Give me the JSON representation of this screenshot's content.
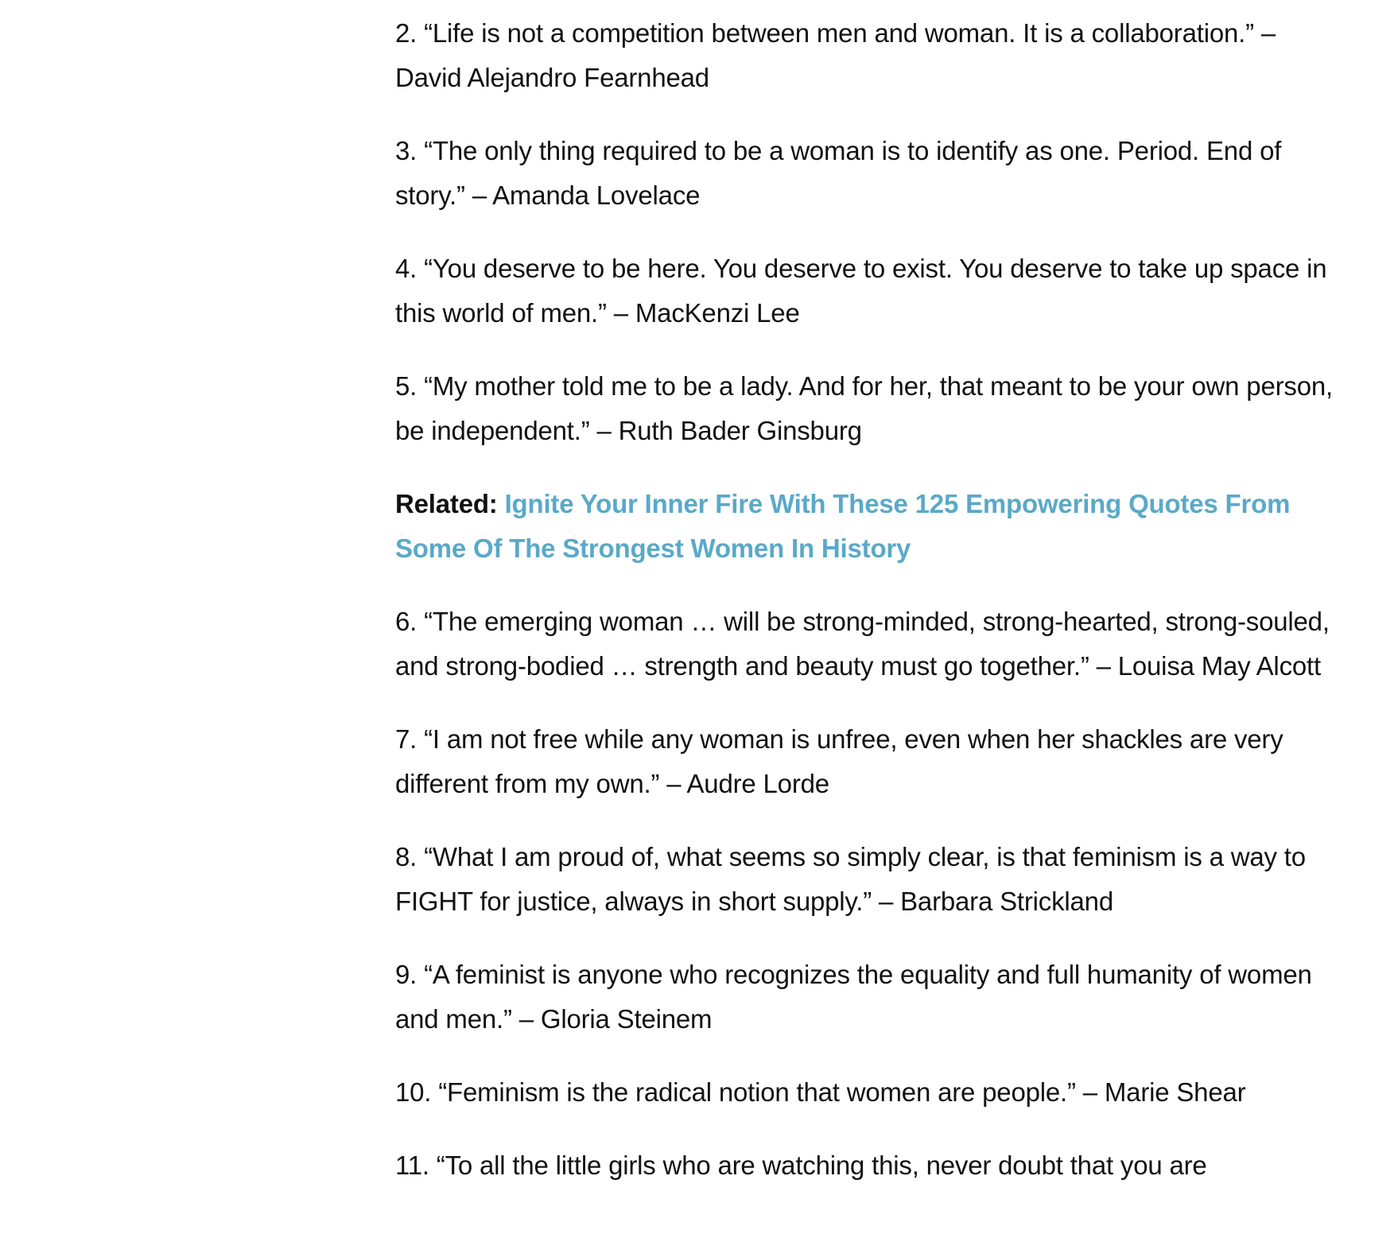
{
  "quotes": [
    {
      "text": "2. “Life is not a competition between men and woman. It is a collaboration.” – David Alejandro Fearnhead"
    },
    {
      "text": "3. “The only thing required to be a woman is to identify as one. Period. End of story.” – Amanda Lovelace"
    },
    {
      "text": "4. “You deserve to be here. You deserve to exist. You deserve to take up space in this world of men.” – MacKenzi Lee"
    },
    {
      "text": "5. “My mother told me to be a lady. And for her, that meant to be your own person, be independent.” – Ruth Bader Ginsburg"
    }
  ],
  "related": {
    "label": "Related:",
    "link_text": "Ignite Your Inner Fire With These 125 Empowering Quotes From Some Of The Strongest Women In History",
    "link_color": "#5aa9c8"
  },
  "quotes_after": [
    {
      "text": "6. “The emerging woman … will be strong-minded, strong-hearted, strong-souled, and strong-bodied … strength and beauty must go together.” – Louisa May Alcott"
    },
    {
      "text": "7. “I am not free while any woman is unfree, even when her shackles are very different from my own.” – Audre Lorde"
    },
    {
      "text": "8. “What I am proud of, what seems so simply clear, is that feminism is a way to FIGHT for justice, always in short supply.” – Barbara Strickland"
    },
    {
      "text": "9. “A feminist is anyone who recognizes the equality and full humanity of women and men.” – Gloria Steinem"
    },
    {
      "text": "10. “Feminism is the radical notion that women are people.” – Marie Shear"
    },
    {
      "text": "11. “To all the little girls who are watching this, never doubt that you are"
    }
  ]
}
